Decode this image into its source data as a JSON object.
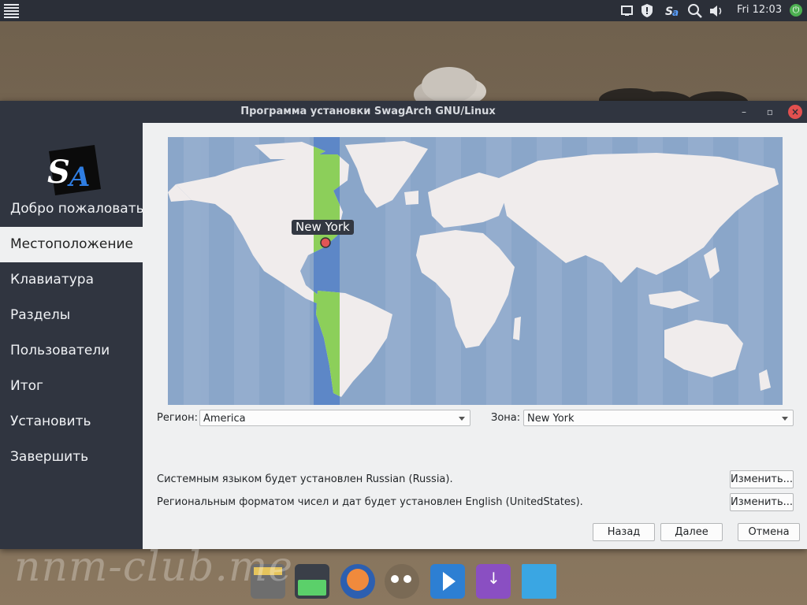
{
  "topbar": {
    "clock": "Fri 12:03",
    "tray_icons": [
      "display-icon",
      "updates-icon",
      "swagarch-icon",
      "search-icon",
      "volume-icon"
    ]
  },
  "window": {
    "title": "Программа установки SwagArch GNU/Linux",
    "controls": {
      "minimize": "–",
      "maximize": "▫",
      "close": "×"
    }
  },
  "sidebar": {
    "items": [
      {
        "label": "Добро пожаловать"
      },
      {
        "label": "Местоположение",
        "active": true
      },
      {
        "label": "Клавиатура"
      },
      {
        "label": "Разделы"
      },
      {
        "label": "Пользователи"
      },
      {
        "label": "Итог"
      },
      {
        "label": "Установить"
      },
      {
        "label": "Завершить"
      }
    ]
  },
  "map": {
    "city": "New York",
    "ocean_color": "#8aa6c9",
    "land_color": "#f0ecec",
    "timezone_band_color": "#5d87c7",
    "timezone_land_color": "#8ccf5a"
  },
  "location": {
    "region_label": "Регион:",
    "region_value": "America",
    "zone_label": "Зона:",
    "zone_value": "New York"
  },
  "locale": {
    "language_text": "Системным языком будет установлен Russian (Russia).",
    "language_button": "Изменить...",
    "format_text": "Региональным форматом чисел и дат будет установлен English (UnitedStates).",
    "format_button": "Изменить..."
  },
  "buttons": {
    "back": "Назад",
    "next": "Далее",
    "cancel": "Отмена"
  },
  "dock": {
    "items": [
      "file-manager-icon",
      "system-monitor-icon",
      "firefox-icon",
      "gimp-icon",
      "media-player-icon",
      "installer-icon",
      "desktop-icon"
    ]
  },
  "watermark": "nnm-club.me"
}
